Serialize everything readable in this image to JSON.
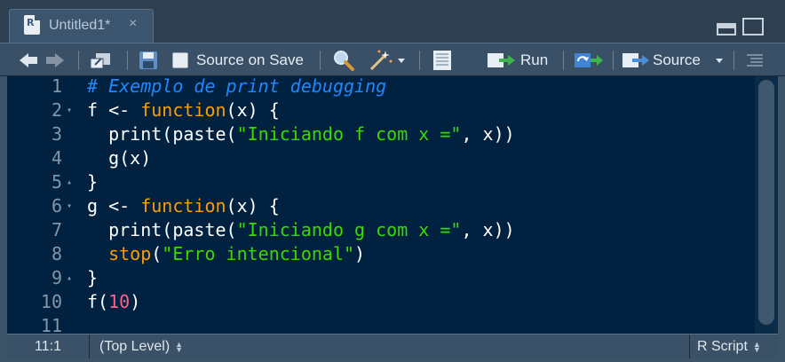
{
  "tab": {
    "title": "Untitled1*",
    "close": "×",
    "file_badge": "R"
  },
  "toolbar": {
    "source_on_save_label": "Source on Save",
    "run_label": "Run",
    "source_label": "Source"
  },
  "editor": {
    "lines": [
      {
        "n": "1",
        "fold": "",
        "parts": [
          [
            "c-comment",
            "# Exemplo de print debugging"
          ]
        ]
      },
      {
        "n": "2",
        "fold": "▾",
        "parts": [
          [
            "",
            "f <- "
          ],
          [
            "c-kw",
            "function"
          ],
          [
            "",
            "(x) {"
          ]
        ]
      },
      {
        "n": "3",
        "fold": "",
        "parts": [
          [
            "",
            "  print(paste("
          ],
          [
            "c-str",
            "\"Iniciando f com x =\""
          ],
          [
            "",
            ", x))"
          ]
        ]
      },
      {
        "n": "4",
        "fold": "",
        "parts": [
          [
            "",
            "  g(x)"
          ]
        ]
      },
      {
        "n": "5",
        "fold": "▴",
        "parts": [
          [
            "",
            "}"
          ]
        ]
      },
      {
        "n": "6",
        "fold": "▾",
        "parts": [
          [
            "",
            "g <- "
          ],
          [
            "c-kw",
            "function"
          ],
          [
            "",
            "(x) {"
          ]
        ]
      },
      {
        "n": "7",
        "fold": "",
        "parts": [
          [
            "",
            "  print(paste("
          ],
          [
            "c-str",
            "\"Iniciando g com x =\""
          ],
          [
            "",
            ", x))"
          ]
        ]
      },
      {
        "n": "8",
        "fold": "",
        "parts": [
          [
            "c-kw",
            "  stop"
          ],
          [
            "",
            "("
          ],
          [
            "c-str",
            "\"Erro intencional\""
          ],
          [
            "",
            ")"
          ]
        ]
      },
      {
        "n": "9",
        "fold": "▴",
        "parts": [
          [
            "",
            "}"
          ]
        ]
      },
      {
        "n": "10",
        "fold": "",
        "parts": [
          [
            "",
            "f("
          ],
          [
            "c-num",
            "10"
          ],
          [
            "",
            ")"
          ]
        ]
      },
      {
        "n": "11",
        "fold": "",
        "parts": []
      }
    ]
  },
  "status": {
    "position": "11:1",
    "scope": "(Top Level)",
    "file_type": "R Script"
  }
}
